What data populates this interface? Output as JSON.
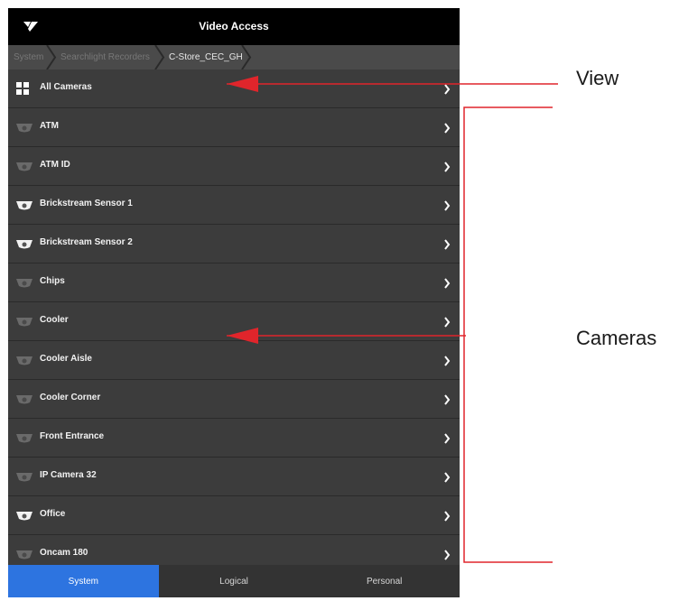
{
  "app": {
    "title": "Video Access"
  },
  "breadcrumb": [
    {
      "label": "System",
      "active": false
    },
    {
      "label": "Searchlight Recorders",
      "active": false
    },
    {
      "label": "C-Store_CEC_GH",
      "active": true
    }
  ],
  "list": [
    {
      "label": "All Cameras",
      "icon": "grid-icon"
    },
    {
      "label": "ATM",
      "icon": "camera-dim-icon"
    },
    {
      "label": "ATM ID",
      "icon": "camera-dim-icon"
    },
    {
      "label": "Brickstream Sensor 1",
      "icon": "camera-white-icon"
    },
    {
      "label": "Brickstream Sensor 2",
      "icon": "camera-white-icon"
    },
    {
      "label": "Chips",
      "icon": "camera-dim-icon"
    },
    {
      "label": "Cooler",
      "icon": "camera-dim-icon"
    },
    {
      "label": "Cooler Aisle",
      "icon": "camera-dim-icon"
    },
    {
      "label": "Cooler Corner",
      "icon": "camera-dim-icon"
    },
    {
      "label": "Front Entrance",
      "icon": "camera-dim-icon"
    },
    {
      "label": "IP Camera 32",
      "icon": "camera-dim-icon"
    },
    {
      "label": "Office",
      "icon": "camera-white-icon"
    },
    {
      "label": "Oncam 180",
      "icon": "camera-dim-icon"
    }
  ],
  "tabs": [
    {
      "label": "System",
      "selected": true
    },
    {
      "label": "Logical",
      "selected": false
    },
    {
      "label": "Personal",
      "selected": false
    }
  ],
  "annotations": {
    "view_label": "View",
    "cameras_label": "Cameras"
  },
  "colors": {
    "accent": "#2d74e0",
    "annotation_arrow": "#e0252b",
    "row_background": "#3c3c3c",
    "titlebar": "#000000"
  }
}
